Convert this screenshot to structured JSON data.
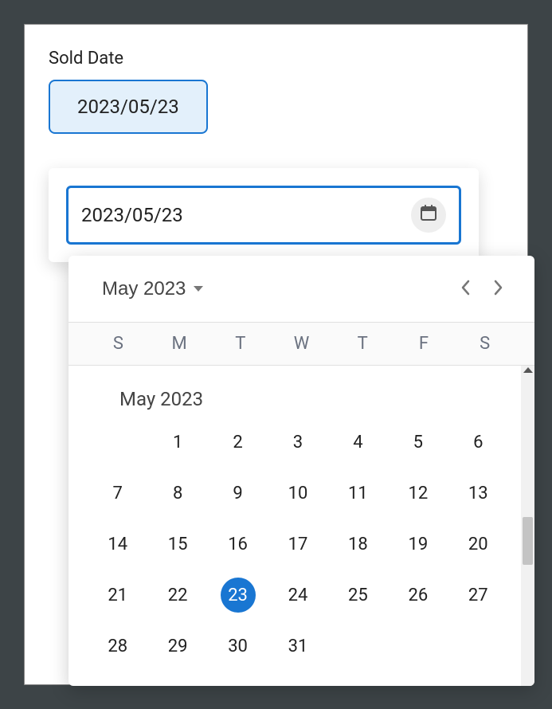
{
  "field": {
    "label": "Sold Date"
  },
  "chip": {
    "value": "2023/05/23"
  },
  "picker": {
    "input_value": "2023/05/23"
  },
  "calendar": {
    "header_month": "May 2023",
    "body_month_label": "May 2023",
    "dow": [
      "S",
      "M",
      "T",
      "W",
      "T",
      "F",
      "S"
    ],
    "leading_blanks": 1,
    "days": [
      1,
      2,
      3,
      4,
      5,
      6,
      7,
      8,
      9,
      10,
      11,
      12,
      13,
      14,
      15,
      16,
      17,
      18,
      19,
      20,
      21,
      22,
      23,
      24,
      25,
      26,
      27,
      28,
      29,
      30,
      31
    ],
    "selected_day": 23
  },
  "colors": {
    "accent": "#1976d2"
  }
}
